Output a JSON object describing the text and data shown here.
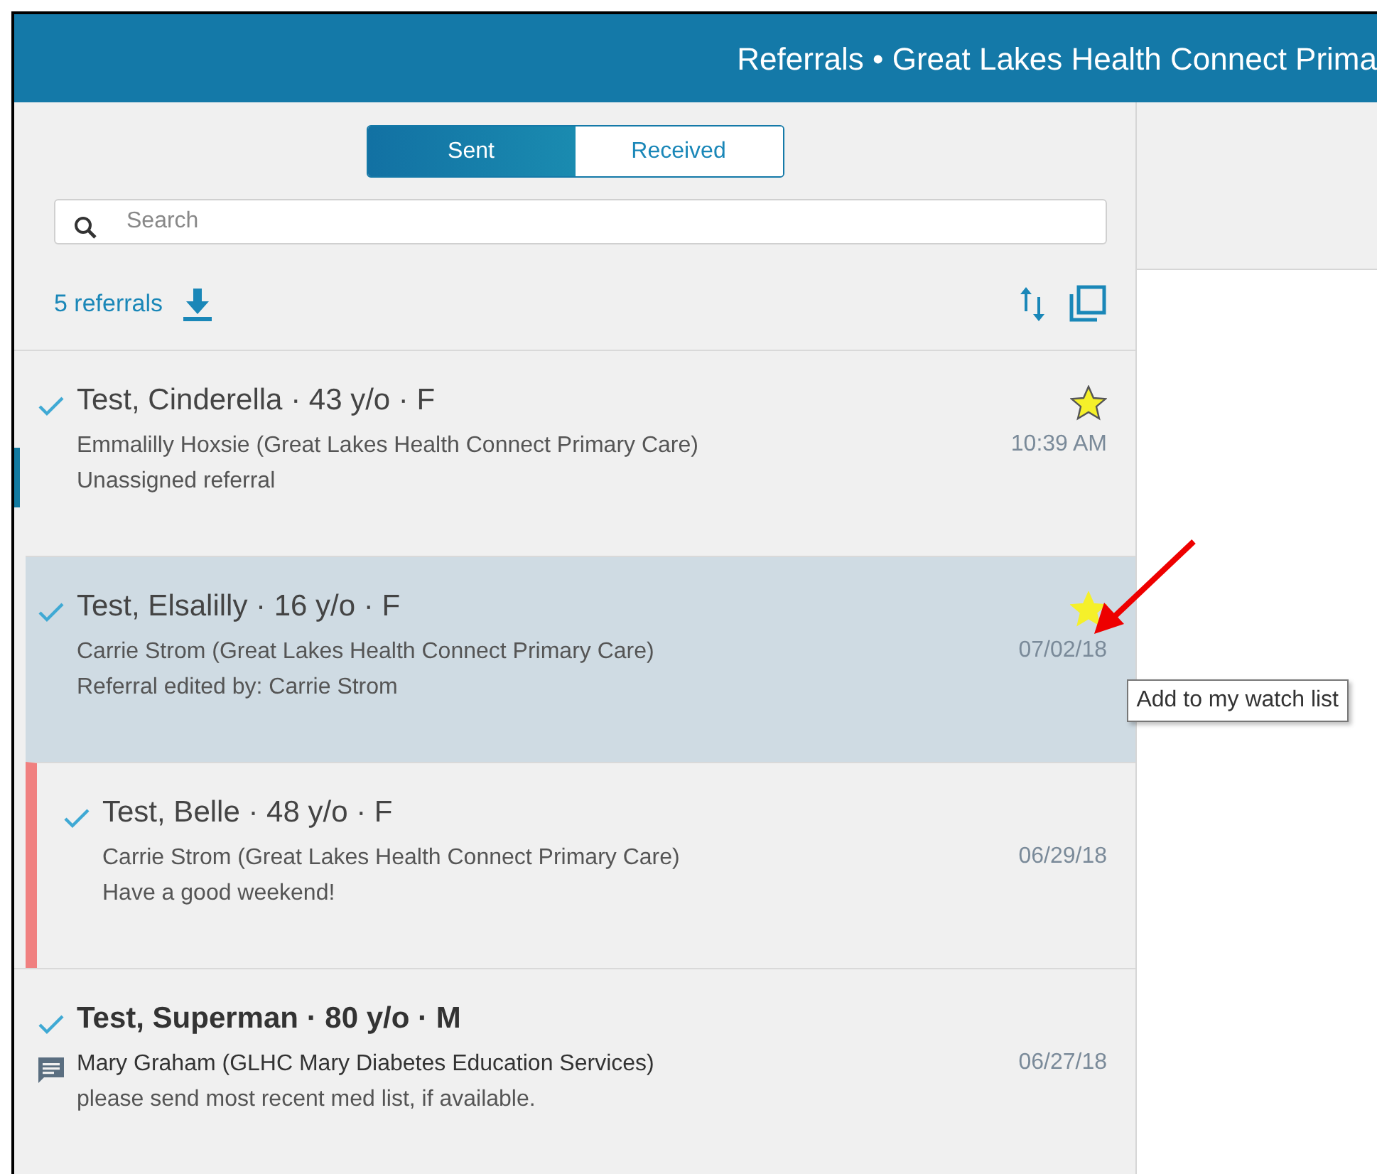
{
  "header": {
    "title": "Referrals • Great Lakes Health Connect Prima"
  },
  "tabs": [
    {
      "label": "Sent",
      "selected": true
    },
    {
      "label": "Received",
      "selected": false
    }
  ],
  "search": {
    "placeholder": "Search"
  },
  "count": "5 referrals",
  "referrals": [
    {
      "name": "Test, Cinderella · 43 y/o · F",
      "from": "Emmalilly Hoxsie (Great Lakes Health Connect Primary Care)",
      "note": "Unassigned referral",
      "time": "10:39 AM",
      "starred": true,
      "selected": false,
      "current": true,
      "unread": false,
      "message": false
    },
    {
      "name": "Test, Elsalilly · 16 y/o · F",
      "from": "Carrie Strom (Great Lakes Health Connect Primary Care)",
      "note": "Referral edited by: Carrie Strom",
      "time": "07/02/18",
      "starred": true,
      "selected": true,
      "current": false,
      "unread": false,
      "message": false,
      "tooltip": "Add to my watch list"
    },
    {
      "name": "Test, Belle · 48 y/o · F",
      "from": "Carrie Strom (Great Lakes Health Connect Primary Care)",
      "note": "Have a good weekend!",
      "time": "06/29/18",
      "starred": false,
      "selected": false,
      "current": false,
      "unread": false,
      "message": false,
      "color": "#f08080"
    },
    {
      "name": "Test, Superman · 80 y/o · M",
      "from": "Mary Graham (GLHC Mary Diabetes Education Services)",
      "note": "please send most recent med list, if available.",
      "time": "06/27/18",
      "starred": false,
      "selected": false,
      "current": false,
      "unread": true,
      "message": true
    }
  ]
}
